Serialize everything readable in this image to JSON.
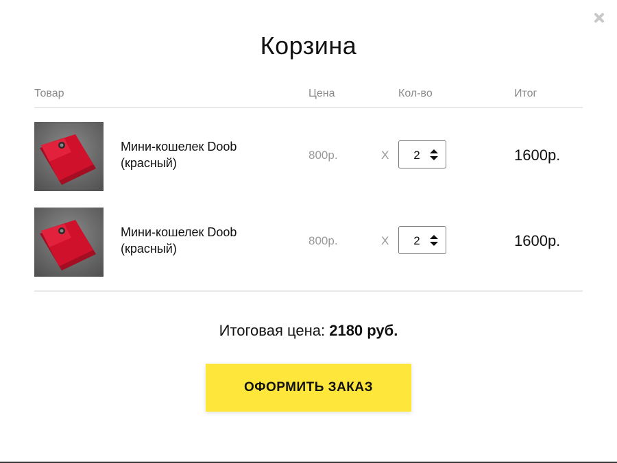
{
  "close": {
    "icon": "close-icon"
  },
  "modal": {
    "title": "Корзина"
  },
  "table": {
    "headers": {
      "product": "Товар",
      "price": "Цена",
      "qty": "Кол-во",
      "total": "Итог"
    },
    "rows": [
      {
        "name": "Мини-кошелек Doob (красный)",
        "price": "800р.",
        "times": "X",
        "qty": "2",
        "total": "1600р.",
        "image": "red-wallet-photo"
      },
      {
        "name": "Мини-кошелек Doob (красный)",
        "price": "800р.",
        "times": "X",
        "qty": "2",
        "total": "1600р.",
        "image": "red-wallet-photo"
      }
    ]
  },
  "summary": {
    "label": "Итоговая цена:",
    "amount": "2180 руб."
  },
  "checkout": {
    "label": "ОФОРМИТЬ ЗАКАЗ"
  },
  "colors": {
    "accent": "#ffe63b",
    "muted": "#9a9a9a",
    "product_red": "#d0112b"
  }
}
